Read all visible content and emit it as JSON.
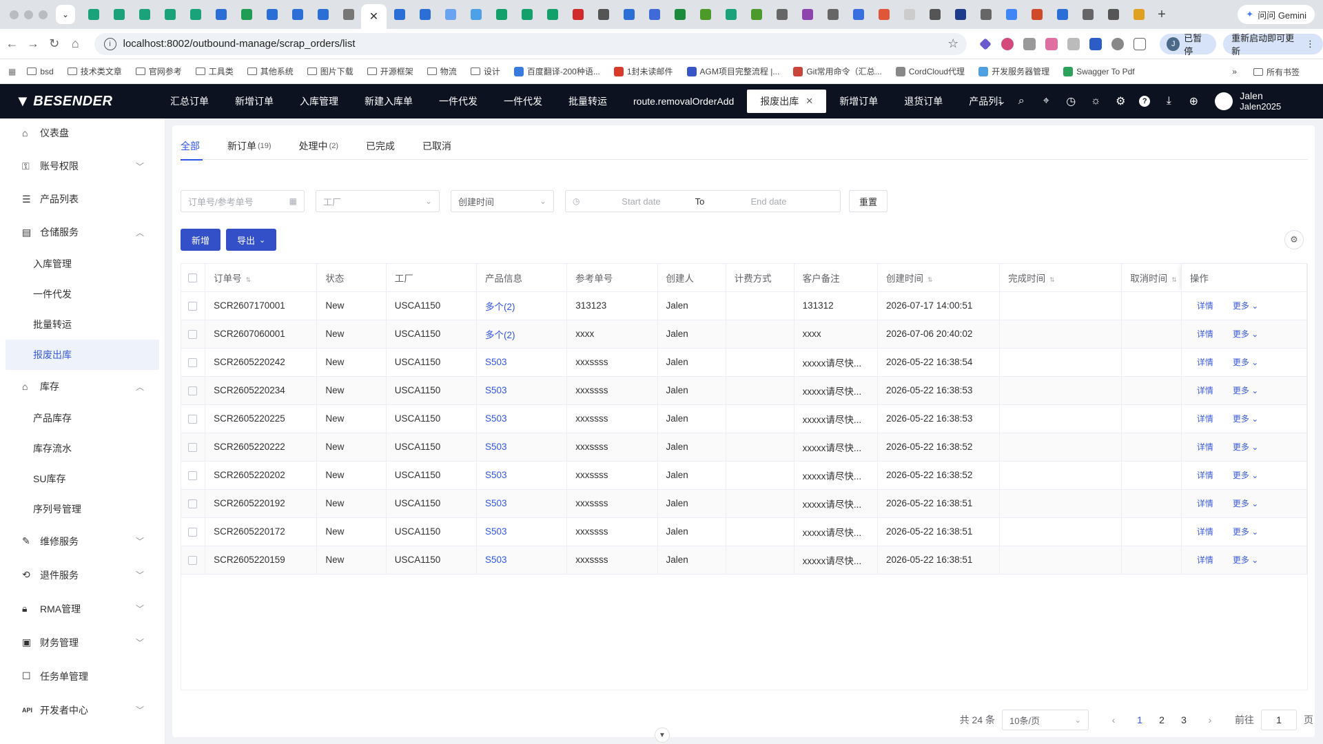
{
  "browser": {
    "url": "localhost:8002/outbound-manage/scrap_orders/list",
    "gemini_label": "问问 Gemini",
    "paused_label": "已暂停",
    "paused_avatar": "J",
    "restart_label": "重新启动即可更新",
    "bookmarks": [
      "bsd",
      "技术类文章",
      "官网参考",
      "工具类",
      "其他系统",
      "图片下载",
      "开源框架",
      "物流",
      "设计",
      "百度翻译-200种语...",
      "1封未读邮件",
      "AGM项目完整流程 |...",
      "Git常用命令（汇总...",
      "CordCloud代理",
      "开发服务器管理",
      "Swagger To Pdf"
    ],
    "bookmarks_all": "所有书签"
  },
  "app": {
    "logo": "BESENDER",
    "topnav": [
      "汇总订单",
      "新增订单",
      "入库管理",
      "新建入库单",
      "一件代发",
      "一件代发",
      "批量转运",
      "route.removalOrderAdd",
      "报废出库",
      "新增订单",
      "退货订单",
      "产品列表"
    ],
    "active_tab_index": 8,
    "user_name": "Jalen",
    "user_account": "Jalen2025"
  },
  "sidebar": {
    "items": [
      {
        "label": "仪表盘",
        "icon": "home-icon",
        "chevron": ""
      },
      {
        "label": "账号权限",
        "icon": "user-key-icon",
        "chevron": "down"
      },
      {
        "label": "产品列表",
        "icon": "list-icon",
        "chevron": ""
      },
      {
        "label": "仓储服务",
        "icon": "warehouse-icon",
        "chevron": "up"
      }
    ],
    "warehouse_sub": [
      "入库管理",
      "一件代发",
      "批量转运",
      "报废出库"
    ],
    "stock": {
      "label": "库存",
      "icon": "store-icon",
      "chevron": "up"
    },
    "stock_sub": [
      "产品库存",
      "库存流水",
      "SU库存",
      "序列号管理"
    ],
    "bottom": [
      {
        "label": "维修服务",
        "icon": "wrench-icon"
      },
      {
        "label": "退件服务",
        "icon": "return-icon"
      },
      {
        "label": "RMA管理",
        "icon": "lock-icon"
      },
      {
        "label": "财务管理",
        "icon": "finance-icon"
      },
      {
        "label": "任务单管理",
        "icon": "task-icon"
      },
      {
        "label": "开发者中心",
        "icon": "api-icon"
      }
    ]
  },
  "tabs": [
    {
      "label": "全部",
      "count": ""
    },
    {
      "label": "新订单",
      "count": "(19)"
    },
    {
      "label": "处理中",
      "count": "(2)"
    },
    {
      "label": "已完成",
      "count": ""
    },
    {
      "label": "已取消",
      "count": ""
    }
  ],
  "filters": {
    "order_placeholder": "订单号/参考单号",
    "factory_placeholder": "工厂",
    "time_type": "创建时间",
    "start_placeholder": "Start date",
    "to_label": "To",
    "end_placeholder": "End date",
    "reset_label": "重置"
  },
  "toolbar": {
    "add_label": "新增",
    "export_label": "导出"
  },
  "table": {
    "headers": [
      "订单号",
      "状态",
      "工厂",
      "产品信息",
      "参考单号",
      "创建人",
      "计费方式",
      "客户备注",
      "创建时间",
      "完成时间",
      "取消时间",
      "操作"
    ],
    "detail_label": "详情",
    "more_label": "更多",
    "rows": [
      [
        "SCR2607170001",
        "New",
        "USCA1150",
        "多个(2)",
        "313123",
        "Jalen",
        "",
        "131312",
        "2026-07-17 14:00:51",
        "",
        ""
      ],
      [
        "SCR2607060001",
        "New",
        "USCA1150",
        "多个(2)",
        "xxxx",
        "Jalen",
        "",
        "xxxx",
        "2026-07-06 20:40:02",
        "",
        ""
      ],
      [
        "SCR2605220242",
        "New",
        "USCA1150",
        "S503",
        "xxxssss",
        "Jalen",
        "",
        "xxxxx请尽快...",
        "2026-05-22 16:38:54",
        "",
        ""
      ],
      [
        "SCR2605220234",
        "New",
        "USCA1150",
        "S503",
        "xxxssss",
        "Jalen",
        "",
        "xxxxx请尽快...",
        "2026-05-22 16:38:53",
        "",
        ""
      ],
      [
        "SCR2605220225",
        "New",
        "USCA1150",
        "S503",
        "xxxssss",
        "Jalen",
        "",
        "xxxxx请尽快...",
        "2026-05-22 16:38:53",
        "",
        ""
      ],
      [
        "SCR2605220222",
        "New",
        "USCA1150",
        "S503",
        "xxxssss",
        "Jalen",
        "",
        "xxxxx请尽快...",
        "2026-05-22 16:38:52",
        "",
        ""
      ],
      [
        "SCR2605220202",
        "New",
        "USCA1150",
        "S503",
        "xxxssss",
        "Jalen",
        "",
        "xxxxx请尽快...",
        "2026-05-22 16:38:52",
        "",
        ""
      ],
      [
        "SCR2605220192",
        "New",
        "USCA1150",
        "S503",
        "xxxssss",
        "Jalen",
        "",
        "xxxxx请尽快...",
        "2026-05-22 16:38:51",
        "",
        ""
      ],
      [
        "SCR2605220172",
        "New",
        "USCA1150",
        "S503",
        "xxxssss",
        "Jalen",
        "",
        "xxxxx请尽快...",
        "2026-05-22 16:38:51",
        "",
        ""
      ],
      [
        "SCR2605220159",
        "New",
        "USCA1150",
        "S503",
        "xxxssss",
        "Jalen",
        "",
        "xxxxx请尽快...",
        "2026-05-22 16:38:51",
        "",
        ""
      ]
    ]
  },
  "pagination": {
    "total": "共 24 条",
    "page_size": "10条/页",
    "pages": [
      "1",
      "2",
      "3"
    ],
    "current": "1",
    "goto_label": "前往",
    "goto_value": "1",
    "page_unit": "页"
  }
}
